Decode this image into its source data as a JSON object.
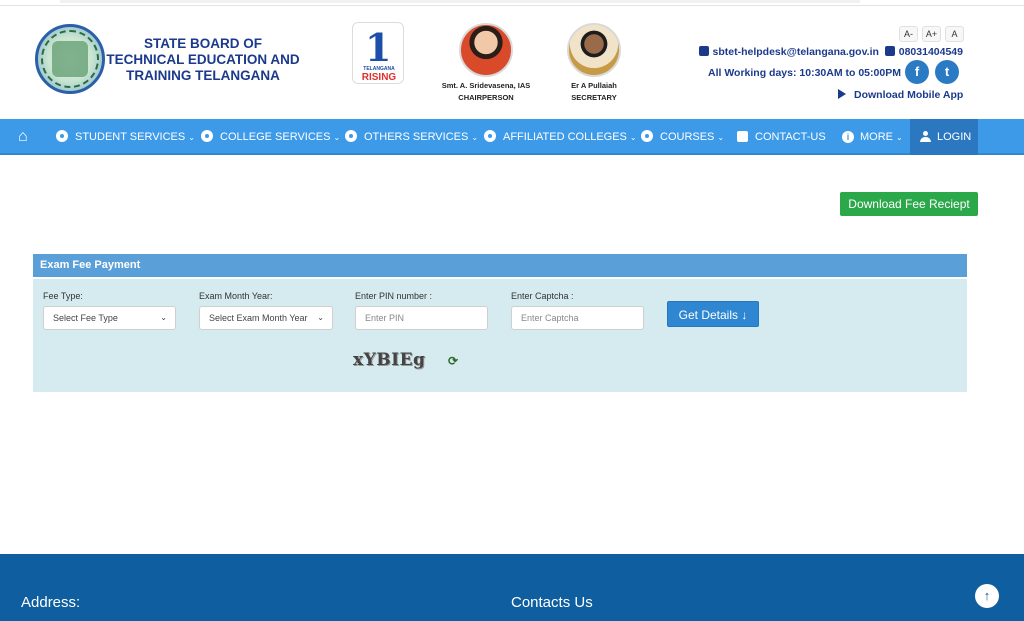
{
  "header": {
    "org_title": "STATE BOARD OF TECHNICAL EDUCATION AND TRAINING TELANGANA",
    "rising_logo": {
      "number": "1",
      "small_text": "TELANGANA",
      "big_text": "RISING"
    },
    "people": [
      {
        "name": "Smt. A. Sridevasena, IAS",
        "role": "CHAIRPERSON"
      },
      {
        "name": "Er A Pullaiah",
        "role": "SECRETARY"
      }
    ],
    "font_controls": [
      "A-",
      "A+",
      "A"
    ],
    "email": "sbtet-helpdesk@telangana.gov.in",
    "phone": "08031404549",
    "working_days": "All Working days: 10:30AM to 05:00PM",
    "social": [
      "f",
      "t"
    ],
    "download_app": "Download Mobile App"
  },
  "nav": {
    "home_icon": "home-icon",
    "items": [
      {
        "label": "STUDENT SERVICES"
      },
      {
        "label": "COLLEGE SERVICES"
      },
      {
        "label": "OTHERS SERVICES"
      },
      {
        "label": "AFFILIATED COLLEGES"
      },
      {
        "label": "COURSES"
      },
      {
        "label": "CONTACT-US"
      },
      {
        "label": "MORE"
      },
      {
        "label": "LOGIN"
      }
    ]
  },
  "main": {
    "download_receipt": "Download Fee Reciept",
    "panel_title": "Exam Fee Payment",
    "fields": {
      "fee_type_label": "Fee Type:",
      "fee_type_value": "Select Fee Type",
      "exam_month_label": "Exam Month Year:",
      "exam_month_value": "Select Exam Month Year",
      "pin_label": "Enter PIN number :",
      "pin_placeholder": "Enter PIN",
      "captcha_label": "Enter Captcha :",
      "captcha_placeholder": "Enter Captcha"
    },
    "get_details": "Get Details ↓",
    "captcha_text": "xYBIEg"
  },
  "footer": {
    "address_title": "Address:",
    "contacts_title": "Contacts Us"
  },
  "colors": {
    "nav_bg": "#3d9ae8",
    "panel_head": "#5a9fd8",
    "panel_body": "#d5ebf0",
    "footer_bg": "#0e5ea0",
    "receipt_btn": "#2aa84a",
    "title_blue": "#1b3a8c"
  }
}
